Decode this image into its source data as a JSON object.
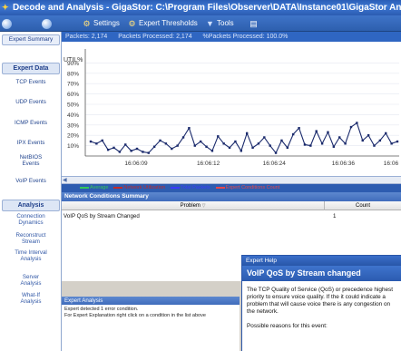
{
  "window": {
    "title": "Decode and Analysis - GigaStor:  C:\\Program Files\\Observer\\DATA\\Instance01\\GigaStor Analysis.bfr"
  },
  "toolbar": {
    "b1": "",
    "b2": "",
    "settings": "Settings",
    "expert_thresholds": "Expert Thresholds",
    "tools": "Tools"
  },
  "sidebar": {
    "tab_summary": "Expert Summary",
    "tab_data": "Expert Data",
    "items": [
      "TCP Events",
      "UDP Events",
      "ICMP Events",
      "IPX Events",
      "NetBIOS Events",
      "VoIP Events"
    ],
    "analysis_heading": "Analysis",
    "analysis_items": [
      "Connection Dynamics",
      "Reconstruct Stream",
      "Time Interval Analysis",
      "Server Analysis",
      "What-If Analysis"
    ]
  },
  "stats": {
    "packets": "Packets: 2,174",
    "processed": "Packets Processed: 2,174",
    "percent": "%Packets Processed: 100.0%"
  },
  "chart_data": {
    "type": "line",
    "y_unit": "UTIL%",
    "y_ticks": [
      "90%",
      "80%",
      "70%",
      "60%",
      "50%",
      "40%",
      "30%",
      "20%",
      "10%"
    ],
    "ylim": [
      0,
      100
    ],
    "x_ticks": [
      "16:06:09",
      "16:06:12",
      "16:06:24",
      "16:06:36",
      "16:06"
    ],
    "series": [
      {
        "values": [
          14,
          12,
          15,
          6,
          8,
          4,
          11,
          5,
          7,
          4,
          3,
          9,
          15,
          12,
          7,
          10,
          18,
          27,
          10,
          14,
          9,
          5,
          19,
          12,
          8,
          14,
          5,
          22,
          8,
          12,
          18,
          10,
          3,
          15,
          8,
          21,
          27,
          11,
          10,
          24,
          12,
          23,
          9,
          18,
          12,
          28,
          32,
          15,
          20,
          10,
          15,
          22,
          12,
          14
        ]
      }
    ],
    "legend": [
      "Average",
      "Network Utilization",
      "Total Packets",
      "Expert Conditions Count"
    ],
    "legend_colors": [
      "#34c759",
      "#c22a2a",
      "#3a3aff",
      "#e5484d"
    ],
    "series_color": "#1a2a6c",
    "grid": true
  },
  "network_conditions": {
    "title": "Network Conditions Summary",
    "col_problem": "Problem",
    "col_count": "Count",
    "rows": [
      {
        "problem": "VoIP QoS by Stream Changed",
        "count": "1"
      }
    ]
  },
  "expert_analysis": {
    "title": "Expert Analysis",
    "line1": "Expert detected 1 error condition.",
    "line2": "For Expert Explanation right click on a condition in the list above"
  },
  "help": {
    "window_title": "Expert Help",
    "title": "VoIP QoS by Stream changed",
    "p1": "The TCP Quality of Service (QoS) or precedence highest priority to ensure voice quality. If the it could indicate a problem that will cause voice there is any congestion on the network.",
    "p2": "Possible reasons for this event:"
  }
}
